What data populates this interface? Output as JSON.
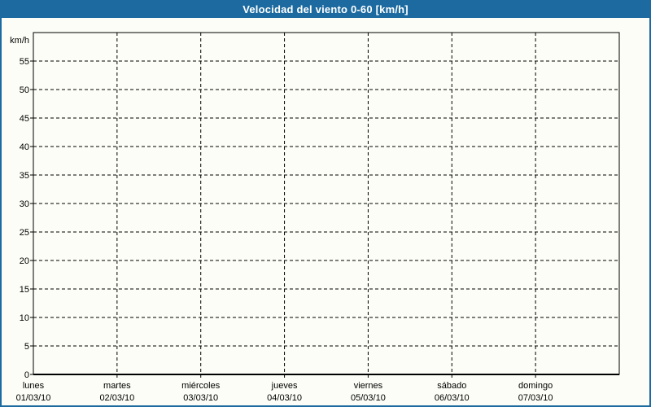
{
  "title_bar": {
    "label": "Velocidad del viento 0-60 [km/h]"
  },
  "colors": {
    "accent_blue": "#1c6aa0",
    "background": "#fbfdf6",
    "grid": "#000000",
    "title_text": "#ffffff",
    "axis_text": "#000000"
  },
  "chart_data": {
    "type": "line",
    "title": "Velocidad del viento 0-60 [km/h]",
    "ylabel": "km/h",
    "ylim": [
      0,
      60
    ],
    "ytick_step": 5,
    "yticks": [
      0,
      5,
      10,
      15,
      20,
      25,
      30,
      35,
      40,
      45,
      50,
      55
    ],
    "categories": [
      {
        "day": "lunes",
        "date": "01/03/10"
      },
      {
        "day": "martes",
        "date": "02/03/10"
      },
      {
        "day": "miércoles",
        "date": "03/03/10"
      },
      {
        "day": "jueves",
        "date": "04/03/10"
      },
      {
        "day": "viernes",
        "date": "05/03/10"
      },
      {
        "day": "sábado",
        "date": "06/03/10"
      },
      {
        "day": "domingo",
        "date": "07/03/10"
      }
    ],
    "series": [],
    "grid": "dashed",
    "legend": "none"
  }
}
